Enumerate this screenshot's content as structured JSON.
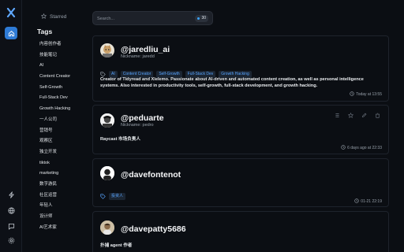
{
  "sidebar": {
    "starred_label": "Starred",
    "tags_title": "Tags",
    "tags": [
      "内容创作者",
      "技能笔记",
      "AI",
      "Content Creator",
      "Self-Growth",
      "Full-Stack Dev",
      "Growth Hacking",
      "一人公司",
      "营销号",
      "观察区",
      "独立开发",
      "tiktok",
      "marketing",
      "数字游民",
      "社区运营",
      "年轻人",
      "设计师",
      "AI艺术家"
    ]
  },
  "search": {
    "placeholder": "Search...",
    "count": "30"
  },
  "cards": [
    {
      "handle": "@jaredliu_ai",
      "nickname": "Nickname: jaredd",
      "tags": [
        "AI",
        "Content Creator",
        "Self-Growth",
        "Full-Stack Dev",
        "Growth Hacking"
      ],
      "bio": "Creator of Tidyread and Xlelemo. Passionate about AI-driven and automated content creation, as well as personal intelligence systems. Also interested in productivity tools, self-growth, full-stack development, and growth hacking.",
      "time": "Today at 13:55"
    },
    {
      "handle": "@peduarte",
      "nickname": "Nickname: pedro",
      "bio": "Raycast 市场负责人",
      "time": "6 days ago at 22:33"
    },
    {
      "handle": "@davefontenot",
      "tags": [
        "投资人"
      ],
      "time": "01-21 22:19"
    },
    {
      "handle": "@davepatty5686",
      "bio": "扑捕 agent 作者"
    }
  ],
  "colors": {
    "accent": "#2e7bd6",
    "chip_text": "#57a4ff",
    "background": "#0b0e13"
  }
}
